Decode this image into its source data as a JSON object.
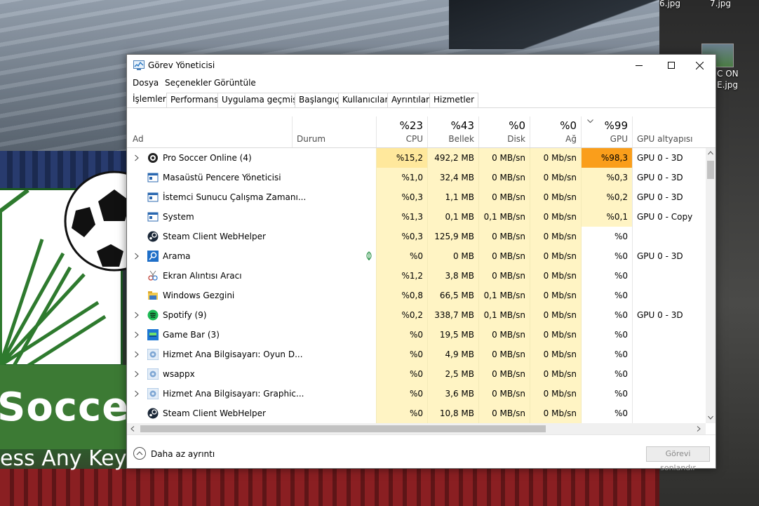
{
  "background": {
    "logo_text": "Soccer",
    "press_text": "ess Any Key To"
  },
  "desktop": {
    "labels": [
      "6.jpg",
      "7.jpg",
      "C ON",
      "E.jpg"
    ]
  },
  "window": {
    "title": "Görev Yöneticisi",
    "menu": [
      "Dosya",
      "Seçenekler",
      "Görüntüle"
    ],
    "tabs": [
      "İşlemler",
      "Performans",
      "Uygulama geçmişi",
      "Başlangıç",
      "Kullanıcılar",
      "Ayrıntılar",
      "Hizmetler"
    ],
    "active_tab": "İşlemler"
  },
  "columns": {
    "name": "Ad",
    "status": "Durum",
    "cpu": {
      "pct": "%23",
      "label": "CPU"
    },
    "mem": {
      "pct": "%43",
      "label": "Bellek"
    },
    "disk": {
      "pct": "%0",
      "label": "Disk"
    },
    "net": {
      "pct": "%0",
      "label": "Ağ"
    },
    "gpu": {
      "pct": "%99",
      "label": "GPU"
    },
    "gpu_engine": "GPU altyapısı"
  },
  "processes": [
    {
      "name": "Pro Soccer Online (4)",
      "expand": true,
      "icon": "soccer-icon",
      "cpu": "%15,2",
      "mem": "492,2 MB",
      "disk": "0 MB/sn",
      "net": "0 Mb/sn",
      "gpu": "%98,3",
      "engine": "GPU 0 - 3D",
      "leaf": false
    },
    {
      "name": "Masaüstü Pencere Yöneticisi",
      "expand": false,
      "icon": "window-app-icon",
      "cpu": "%1,0",
      "mem": "32,4 MB",
      "disk": "0 MB/sn",
      "net": "0 Mb/sn",
      "gpu": "%0,3",
      "engine": "GPU 0 - 3D",
      "leaf": false
    },
    {
      "name": "İstemci Sunucu Çalışma Zamanı...",
      "expand": false,
      "icon": "window-app-icon",
      "cpu": "%0,3",
      "mem": "1,1 MB",
      "disk": "0 MB/sn",
      "net": "0 Mb/sn",
      "gpu": "%0,2",
      "engine": "GPU 0 - 3D",
      "leaf": false
    },
    {
      "name": "System",
      "expand": false,
      "icon": "window-app-icon",
      "cpu": "%1,3",
      "mem": "0,1 MB",
      "disk": "0,1 MB/sn",
      "net": "0 Mb/sn",
      "gpu": "%0,1",
      "engine": "GPU 0 - Copy",
      "leaf": false
    },
    {
      "name": "Steam Client WebHelper",
      "expand": false,
      "icon": "steam-icon",
      "cpu": "%0,3",
      "mem": "125,9 MB",
      "disk": "0 MB/sn",
      "net": "0 Mb/sn",
      "gpu": "%0",
      "engine": "",
      "leaf": false
    },
    {
      "name": "Arama",
      "expand": true,
      "icon": "search-app-icon",
      "cpu": "%0",
      "mem": "0 MB",
      "disk": "0 MB/sn",
      "net": "0 Mb/sn",
      "gpu": "%0",
      "engine": "GPU 0 - 3D",
      "leaf": true
    },
    {
      "name": "Ekran Alıntısı Aracı",
      "expand": false,
      "icon": "snipping-tool-icon",
      "cpu": "%1,2",
      "mem": "3,8 MB",
      "disk": "0 MB/sn",
      "net": "0 Mb/sn",
      "gpu": "%0",
      "engine": "",
      "leaf": false
    },
    {
      "name": "Windows Gezgini",
      "expand": false,
      "icon": "folder-icon",
      "cpu": "%0,8",
      "mem": "66,5 MB",
      "disk": "0,1 MB/sn",
      "net": "0 Mb/sn",
      "gpu": "%0",
      "engine": "",
      "leaf": false
    },
    {
      "name": "Spotify (9)",
      "expand": true,
      "icon": "spotify-icon",
      "cpu": "%0,2",
      "mem": "338,7 MB",
      "disk": "0,1 MB/sn",
      "net": "0 Mb/sn",
      "gpu": "%0",
      "engine": "GPU 0 - 3D",
      "leaf": false
    },
    {
      "name": "Game Bar (3)",
      "expand": true,
      "icon": "game-bar-icon",
      "cpu": "%0",
      "mem": "19,5 MB",
      "disk": "0 MB/sn",
      "net": "0 Mb/sn",
      "gpu": "%0",
      "engine": "",
      "leaf": false
    },
    {
      "name": "Hizmet Ana Bilgisayarı: Oyun D...",
      "expand": true,
      "icon": "gear-icon",
      "cpu": "%0",
      "mem": "4,9 MB",
      "disk": "0 MB/sn",
      "net": "0 Mb/sn",
      "gpu": "%0",
      "engine": "",
      "leaf": false
    },
    {
      "name": "wsappx",
      "expand": true,
      "icon": "gear-icon",
      "cpu": "%0",
      "mem": "2,5 MB",
      "disk": "0 MB/sn",
      "net": "0 Mb/sn",
      "gpu": "%0",
      "engine": "",
      "leaf": false
    },
    {
      "name": "Hizmet Ana Bilgisayarı: Graphic...",
      "expand": true,
      "icon": "gear-icon",
      "cpu": "%0",
      "mem": "3,6 MB",
      "disk": "0 MB/sn",
      "net": "0 Mb/sn",
      "gpu": "%0",
      "engine": "",
      "leaf": false
    },
    {
      "name": "Steam Client WebHelper",
      "expand": false,
      "icon": "steam-icon",
      "cpu": "%0",
      "mem": "10,8 MB",
      "disk": "0 MB/sn",
      "net": "0 Mb/sn",
      "gpu": "%0",
      "engine": "",
      "leaf": false
    }
  ],
  "footer": {
    "fewer_details": "Daha az ayrıntı",
    "end_task": "Görevi sonlandır"
  },
  "colors": {
    "heat_low": "#fff4c4",
    "heat_mid": "#ffe89c",
    "heat_high": "#f9a825",
    "gpu_high": "#fa9e1b"
  }
}
